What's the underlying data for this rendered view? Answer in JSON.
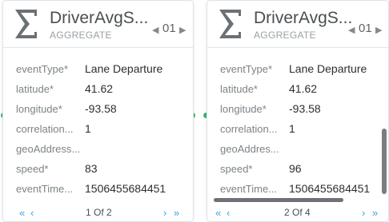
{
  "cards": [
    {
      "title": "DriverAvgS...",
      "type": "AGGREGATE",
      "badge": "01",
      "fields": [
        {
          "key": "eventType*",
          "value": "Lane Departure"
        },
        {
          "key": "latitude*",
          "value": "41.62"
        },
        {
          "key": "longitude*",
          "value": "-93.58"
        },
        {
          "key": "correlation...",
          "value": "1"
        },
        {
          "key": "geoAddress...",
          "value": ""
        },
        {
          "key": "speed*",
          "value": "83"
        },
        {
          "key": "eventTime...",
          "value": "1506455684451"
        }
      ],
      "pager": {
        "label": "1 Of 2",
        "first": "«",
        "prev": "‹",
        "next": "›",
        "last": "»"
      }
    },
    {
      "title": "DriverAvgS...",
      "type": "AGGREGATE",
      "badge": "01",
      "fields": [
        {
          "key": "eventType*",
          "value": "Lane Departure"
        },
        {
          "key": "latitude*",
          "value": "41.62"
        },
        {
          "key": "longitude*",
          "value": "-93.58"
        },
        {
          "key": "correlation...",
          "value": "1"
        },
        {
          "key": "geoAddres...",
          "value": ""
        },
        {
          "key": "speed*",
          "value": "96"
        },
        {
          "key": "eventTime...",
          "value": "1506455684451"
        }
      ],
      "pager": {
        "label": "2 Of 4",
        "first": "«",
        "prev": "‹",
        "next": "›",
        "last": "»"
      }
    }
  ],
  "colors": {
    "accent": "#3aa0e8",
    "connector": "#3cb371"
  },
  "icons": [
    "sigma-icon",
    "pointer-left-icon",
    "pointer-right-icon"
  ]
}
